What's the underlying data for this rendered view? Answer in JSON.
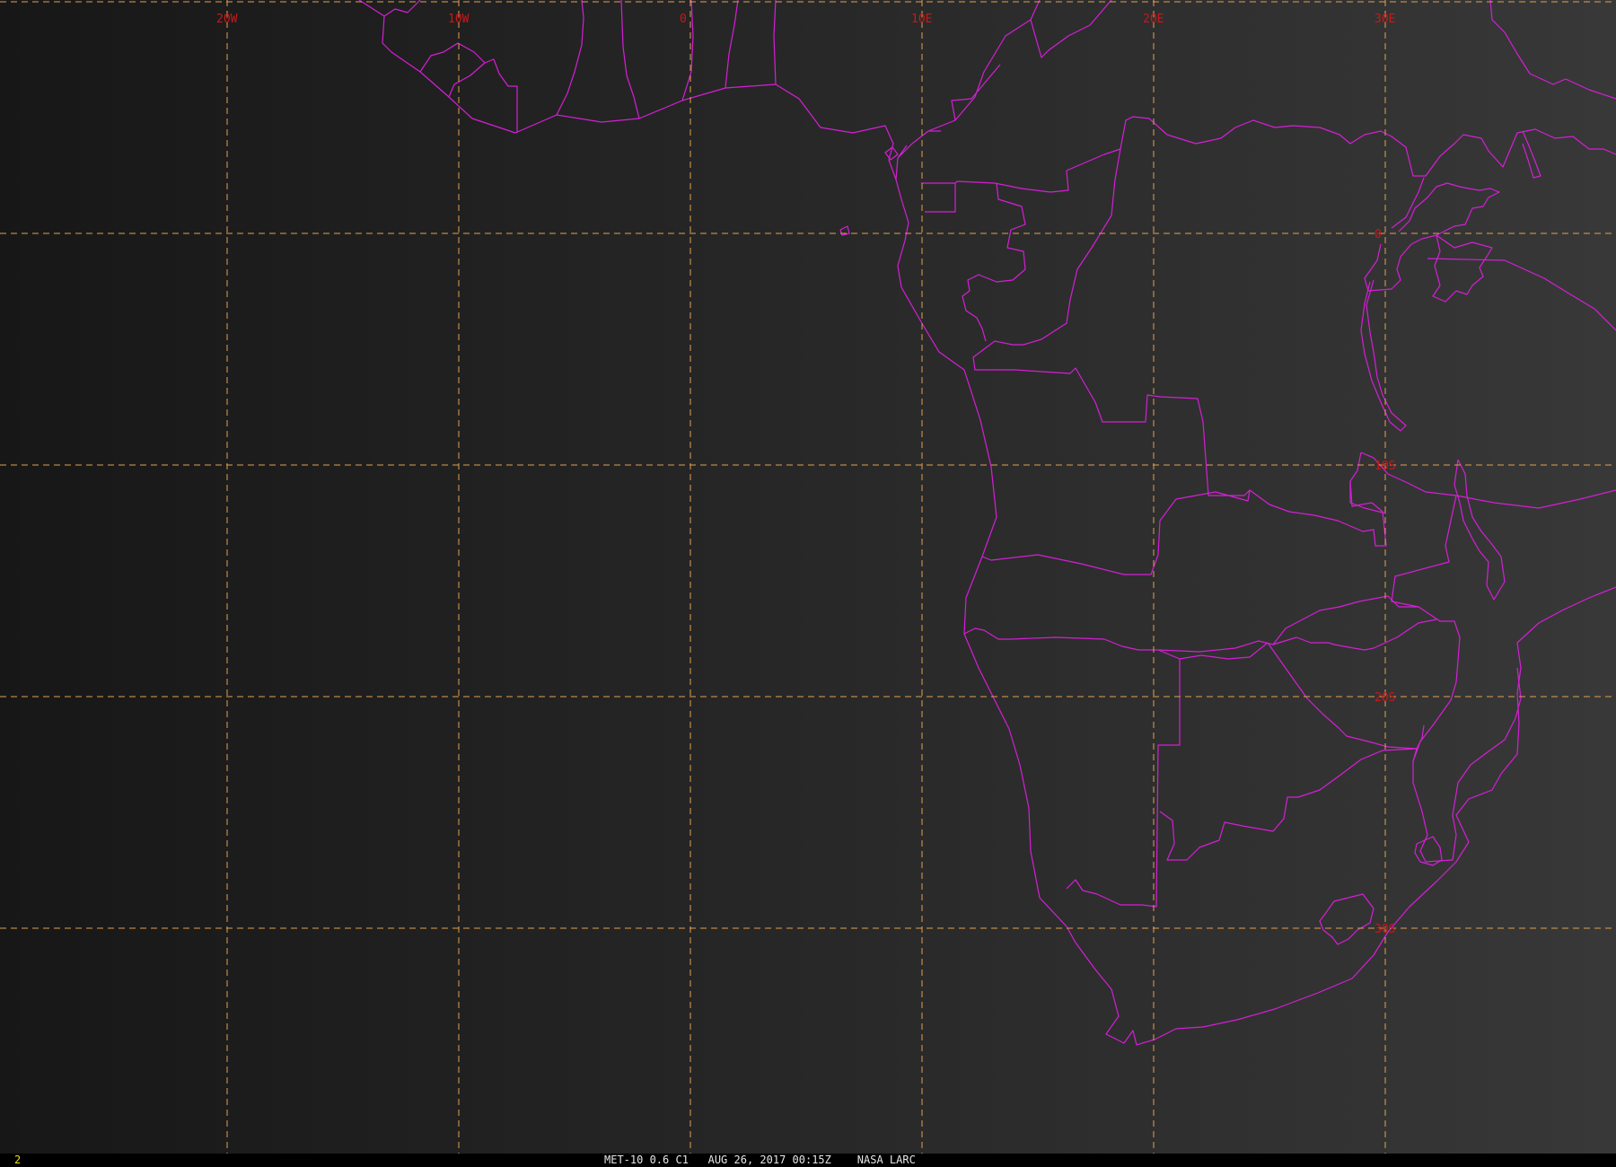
{
  "map": {
    "colors": {
      "background_left": "#171717",
      "background_right": "#383838",
      "coastline": "#d51fd6",
      "graticule": "#e0a050",
      "grid_label": "#c8181a",
      "frame_number": "#e8e000",
      "caption": "#e6e6e6"
    },
    "longitude_labels": [
      {
        "lon": -20,
        "text": "20W"
      },
      {
        "lon": -10,
        "text": "10W"
      },
      {
        "lon": 0,
        "text": "0"
      },
      {
        "lon": 10,
        "text": "10E"
      },
      {
        "lon": 20,
        "text": "20E"
      },
      {
        "lon": 30,
        "text": "30E"
      }
    ],
    "latitude_labels": [
      {
        "lat": 0,
        "text": "0"
      },
      {
        "lat": -10,
        "text": "10S"
      },
      {
        "lat": -20,
        "text": "20S"
      },
      {
        "lat": -30,
        "text": "30S"
      }
    ],
    "latitude_top_line": 10
  },
  "status_bar": {
    "frame_number": "2",
    "satellite": "MET-10 0.6 C1",
    "datetime": "AUG 26, 2017 00:15Z",
    "source": "NASA LARC"
  }
}
